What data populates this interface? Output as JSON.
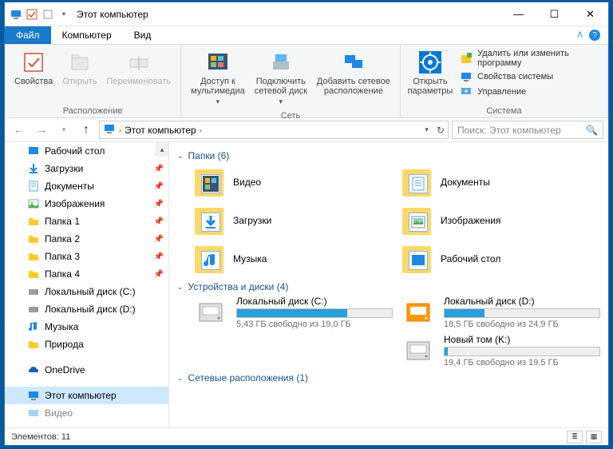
{
  "window": {
    "title": "Этот компьютер"
  },
  "menubar": {
    "file": "Файл",
    "computer": "Компьютер",
    "view": "Вид"
  },
  "ribbon": {
    "location": {
      "properties": "Свойства",
      "open": "Открыть",
      "rename": "Переименовать",
      "group_label": "Расположение"
    },
    "network": {
      "media": "Доступ к\nмультимедиа",
      "map_drive": "Подключить\nсетевой диск",
      "add_location": "Добавить сетевое\nрасположение",
      "group_label": "Сеть"
    },
    "system": {
      "open_settings": "Открыть\nпараметры",
      "uninstall": "Удалить или изменить программу",
      "sys_props": "Свойства системы",
      "manage": "Управление",
      "group_label": "Система"
    }
  },
  "addressbar": {
    "path_label": "Этот компьютер",
    "search_placeholder": "Поиск: Этот компьютер"
  },
  "nav": {
    "items": [
      {
        "label": "Рабочий стол",
        "icon": "desktop",
        "color": "#1e88e5",
        "pin": true
      },
      {
        "label": "Загрузки",
        "icon": "download",
        "color": "#1e88e5",
        "pin": true
      },
      {
        "label": "Документы",
        "icon": "doc",
        "color": "#5aa7e0",
        "pin": true
      },
      {
        "label": "Изображения",
        "icon": "image",
        "color": "#5aa7e0",
        "pin": true
      },
      {
        "label": "Папка 1",
        "icon": "folder",
        "color": "#ffca28",
        "pin": true
      },
      {
        "label": "Папка 2",
        "icon": "folder",
        "color": "#ffca28",
        "pin": true
      },
      {
        "label": "Папка 3",
        "icon": "folder",
        "color": "#ffca28",
        "pin": true
      },
      {
        "label": "Папка 4",
        "icon": "folder",
        "color": "#ffca28",
        "pin": true
      },
      {
        "label": "Локальный диск (C:)",
        "icon": "drive",
        "color": "#757575",
        "pin": false
      },
      {
        "label": "Локальный диск (D:)",
        "icon": "drive",
        "color": "#757575",
        "pin": false
      },
      {
        "label": "Музыка",
        "icon": "music",
        "color": "#1e88e5",
        "pin": false
      },
      {
        "label": "Природа",
        "icon": "folder",
        "color": "#ffca28",
        "pin": false
      }
    ],
    "onedrive": "OneDrive",
    "this_pc": "Этот компьютер",
    "video": "Видео"
  },
  "sections": {
    "folders": {
      "label": "Папки (6)"
    },
    "devices": {
      "label": "Устройства и диски (4)"
    },
    "network": {
      "label": "Сетевые расположения (1)"
    }
  },
  "folders": [
    {
      "label": "Видео",
      "overlay": "video"
    },
    {
      "label": "Документы",
      "overlay": "doc"
    },
    {
      "label": "Загрузки",
      "overlay": "download"
    },
    {
      "label": "Изображения",
      "overlay": "image"
    },
    {
      "label": "Музыка",
      "overlay": "music"
    },
    {
      "label": "Рабочий стол",
      "overlay": "desktop"
    }
  ],
  "drives": [
    {
      "label": "Локальный диск (C:)",
      "space": "5,43 ГБ свободно из 19,0 ГБ",
      "fill": 71,
      "icon": "hdd"
    },
    {
      "label": "Локальный диск (D:)",
      "space": "18,5 ГБ свободно из 24,9 ГБ",
      "fill": 26,
      "icon": "hdd-orange"
    },
    {
      "label": "Новый том (K:)",
      "space": "19,4 ГБ свободно из 19,5 ГБ",
      "fill": 2,
      "icon": "hdd",
      "col": 2
    }
  ],
  "statusbar": {
    "count": "Элементов: 11"
  }
}
